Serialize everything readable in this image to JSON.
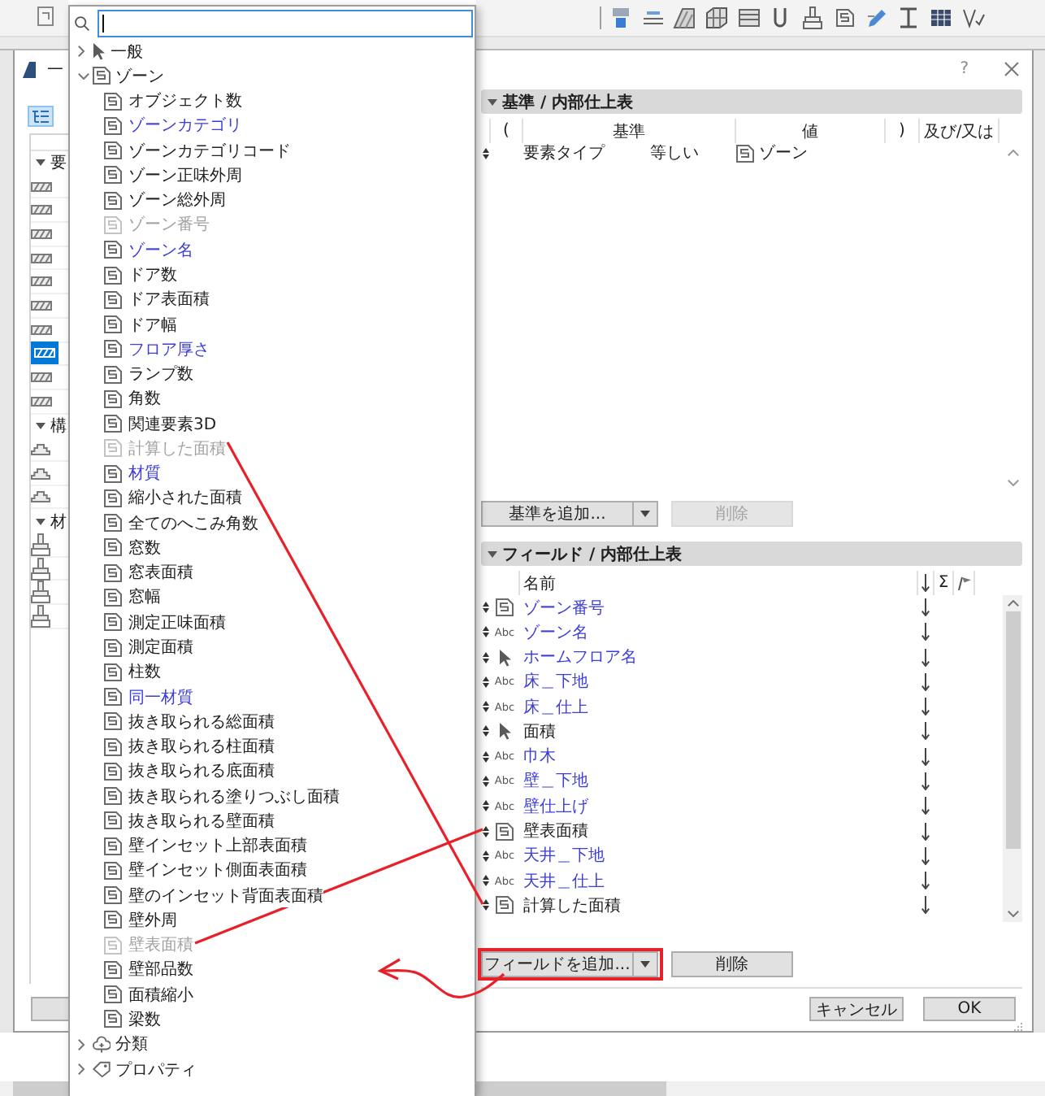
{
  "dialog": {
    "title": "一",
    "help": "?"
  },
  "left_panel": {
    "groups": [
      {
        "label": "要",
        "expanded": true,
        "items": [
          {
            "kind": "wall",
            "selected": false
          },
          {
            "kind": "wall",
            "selected": false
          },
          {
            "kind": "wall",
            "selected": false
          },
          {
            "kind": "wall",
            "selected": false
          },
          {
            "kind": "wall",
            "selected": false
          },
          {
            "kind": "wall",
            "selected": false
          },
          {
            "kind": "wall",
            "selected": false
          },
          {
            "kind": "wall",
            "selected": true
          },
          {
            "kind": "wall",
            "selected": false
          },
          {
            "kind": "wall",
            "selected": false
          }
        ]
      },
      {
        "label": "構",
        "expanded": true,
        "items": [
          {
            "kind": "stair",
            "selected": false
          },
          {
            "kind": "stair",
            "selected": false
          },
          {
            "kind": "stair",
            "selected": false
          }
        ]
      },
      {
        "label": "材",
        "expanded": true,
        "items": [
          {
            "kind": "brush",
            "selected": false
          },
          {
            "kind": "brush",
            "selected": false
          },
          {
            "kind": "brush",
            "selected": false
          },
          {
            "kind": "brush",
            "selected": false
          }
        ]
      }
    ]
  },
  "popup": {
    "search": {
      "focused": true
    },
    "tree": [
      {
        "label": "一般",
        "kind": "pointer",
        "expanded": false
      },
      {
        "label": "ゾーン",
        "kind": "zone",
        "expanded": true,
        "children": [
          {
            "label": "オブジェクト数",
            "highlighted": false,
            "disabled": false
          },
          {
            "label": "ゾーンカテゴリ",
            "highlighted": true,
            "disabled": false
          },
          {
            "label": "ゾーンカテゴリコード",
            "highlighted": false,
            "disabled": false
          },
          {
            "label": "ゾーン正味外周",
            "highlighted": false,
            "disabled": false
          },
          {
            "label": "ゾーン総外周",
            "highlighted": false,
            "disabled": false
          },
          {
            "label": "ゾーン番号",
            "highlighted": false,
            "disabled": true
          },
          {
            "label": "ゾーン名",
            "highlighted": true,
            "disabled": false
          },
          {
            "label": "ドア数",
            "highlighted": false,
            "disabled": false
          },
          {
            "label": "ドア表面積",
            "highlighted": false,
            "disabled": false
          },
          {
            "label": "ドア幅",
            "highlighted": false,
            "disabled": false
          },
          {
            "label": "フロア厚さ",
            "highlighted": true,
            "disabled": false
          },
          {
            "label": "ランプ数",
            "highlighted": false,
            "disabled": false
          },
          {
            "label": "角数",
            "highlighted": false,
            "disabled": false
          },
          {
            "label": "関連要素3D",
            "highlighted": false,
            "disabled": false
          },
          {
            "label": "計算した面積",
            "highlighted": false,
            "disabled": true
          },
          {
            "label": "材質",
            "highlighted": true,
            "disabled": false
          },
          {
            "label": "縮小された面積",
            "highlighted": false,
            "disabled": false
          },
          {
            "label": "全てのへこみ角数",
            "highlighted": false,
            "disabled": false
          },
          {
            "label": "窓数",
            "highlighted": false,
            "disabled": false
          },
          {
            "label": "窓表面積",
            "highlighted": false,
            "disabled": false
          },
          {
            "label": "窓幅",
            "highlighted": false,
            "disabled": false
          },
          {
            "label": "測定正味面積",
            "highlighted": false,
            "disabled": false
          },
          {
            "label": "測定面積",
            "highlighted": false,
            "disabled": false
          },
          {
            "label": "柱数",
            "highlighted": false,
            "disabled": false
          },
          {
            "label": "同一材質",
            "highlighted": true,
            "disabled": false
          },
          {
            "label": "抜き取られる総面積",
            "highlighted": false,
            "disabled": false
          },
          {
            "label": "抜き取られる柱面積",
            "highlighted": false,
            "disabled": false
          },
          {
            "label": "抜き取られる底面積",
            "highlighted": false,
            "disabled": false
          },
          {
            "label": "抜き取られる塗りつぶし面積",
            "highlighted": false,
            "disabled": false
          },
          {
            "label": "抜き取られる壁面積",
            "highlighted": false,
            "disabled": false
          },
          {
            "label": "壁インセット上部表面積",
            "highlighted": false,
            "disabled": false
          },
          {
            "label": "壁インセット側面表面積",
            "highlighted": false,
            "disabled": false
          },
          {
            "label": "壁のインセット背面表面積",
            "highlighted": false,
            "disabled": false
          },
          {
            "label": "壁外周",
            "highlighted": false,
            "disabled": false
          },
          {
            "label": "壁表面積",
            "highlighted": false,
            "disabled": true
          },
          {
            "label": "壁部品数",
            "highlighted": false,
            "disabled": false
          },
          {
            "label": "面積縮小",
            "highlighted": false,
            "disabled": false
          },
          {
            "label": "梁数",
            "highlighted": false,
            "disabled": false
          }
        ]
      },
      {
        "label": "分類",
        "kind": "cloud",
        "expanded": false
      },
      {
        "label": "プロパティ",
        "kind": "tag",
        "expanded": false
      }
    ]
  },
  "criteria": {
    "title": "基準 / 内部仕上表",
    "expanded": true,
    "columns": [
      "(",
      "基準",
      "値",
      ")",
      "及び/又は"
    ],
    "rows": [
      {
        "element": "要素タイプ",
        "operator": "等しい",
        "value": "ゾーン",
        "kind": "zone"
      }
    ],
    "add_button": "基準を追加...",
    "delete_button": {
      "label": "削除",
      "disabled": true
    }
  },
  "fields": {
    "title": "フィールド / 内部仕上表",
    "expanded": true,
    "columns": {
      "name": "名前",
      "sum": "Σ"
    },
    "rows": [
      {
        "kind": "zone",
        "name": "ゾーン番号",
        "highlighted": true
      },
      {
        "kind": "text",
        "badge": "Abc",
        "name": "ゾーン名",
        "highlighted": true
      },
      {
        "kind": "pointer",
        "name": "ホームフロア名",
        "highlighted": true
      },
      {
        "kind": "text",
        "badge": "Abc",
        "name": "床＿下地",
        "highlighted": true
      },
      {
        "kind": "text",
        "badge": "Abc",
        "name": "床＿仕上",
        "highlighted": true
      },
      {
        "kind": "pointer",
        "name": "面積",
        "highlighted": false
      },
      {
        "kind": "text",
        "badge": "Abc",
        "name": "巾木",
        "highlighted": true
      },
      {
        "kind": "text",
        "badge": "Abc",
        "name": "壁＿下地",
        "highlighted": true
      },
      {
        "kind": "text",
        "badge": "Abc",
        "name": "壁仕上げ",
        "highlighted": true
      },
      {
        "kind": "zone",
        "name": "壁表面積",
        "highlighted": false
      },
      {
        "kind": "text",
        "badge": "Abc",
        "name": "天井＿下地",
        "highlighted": true
      },
      {
        "kind": "text",
        "badge": "Abc",
        "name": "天井＿仕上",
        "highlighted": true
      },
      {
        "kind": "zone",
        "name": "計算した面積",
        "highlighted": false
      }
    ],
    "add_button": "フィールドを追加...",
    "delete_button": {
      "label": "削除",
      "disabled": false
    }
  },
  "footer": {
    "cancel": "キャンセル",
    "ok": "OK"
  },
  "annotations": [
    {
      "kind": "line"
    },
    {
      "kind": "line"
    },
    {
      "kind": "curved-arrow"
    },
    {
      "kind": "frame"
    }
  ]
}
